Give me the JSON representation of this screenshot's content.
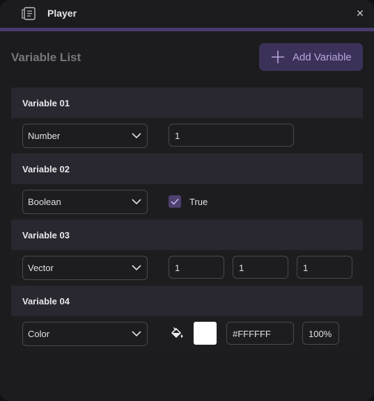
{
  "window": {
    "title": "Player",
    "accent_color": "#4a3b6e"
  },
  "header": {
    "title": "Variable List",
    "add_button_label": "Add Variable"
  },
  "variables": [
    {
      "name": "Variable 01",
      "type": "Number",
      "value": "1"
    },
    {
      "name": "Variable 02",
      "type": "Boolean",
      "checked": true,
      "label": "True"
    },
    {
      "name": "Variable 03",
      "type": "Vector",
      "x": "1",
      "y": "1",
      "z": "1"
    },
    {
      "name": "Variable 04",
      "type": "Color",
      "color": "#FFFFFF",
      "hex": "#FFFFFF",
      "alpha": "100%"
    }
  ],
  "icons": {
    "app": "document-icon",
    "close": "close-icon",
    "add": "plus-icon",
    "dropdown": "chevron-down-icon",
    "fill": "paint-bucket-icon",
    "check": "checkmark-icon"
  }
}
